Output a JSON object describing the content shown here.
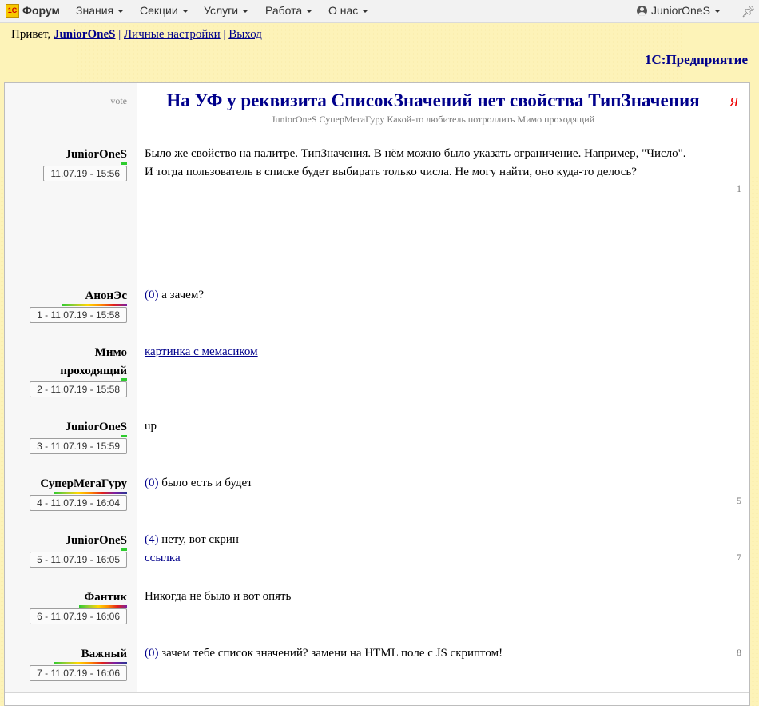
{
  "topnav": {
    "logo_text": "1C",
    "brand": "Форум",
    "menus": [
      "Знания",
      "Секции",
      "Услуги",
      "Работа",
      "О нас"
    ],
    "user": "JuniorOneS"
  },
  "greeting": {
    "prefix": "Привет,",
    "username": "JuniorOneS",
    "sep1": "|",
    "settings": "Личные настройки",
    "sep2": "|",
    "logout": "Выход"
  },
  "section_title": "1С:Предприятие",
  "topic": {
    "vote_label": "vote",
    "title": "На УФ у реквизита СписокЗначений нет свойства ТипЗначения",
    "participants": "JuniorOneS СуперМегаГуру Какой-то любитель потроллить Мимо проходящий",
    "ya_icon": "Я"
  },
  "posts": [
    {
      "author": "JuniorOneS",
      "timestamp": "11.07.19 - 15:56",
      "text": "Было же свойство на палитре. ТипЗначения. В нём можно было указать ограничение. Например, \"Число\". И тогда пользователь в списке будет выбирать только числа. Не могу найти, оно куда-то делось?",
      "num": "1"
    },
    {
      "author": "АнонЭс",
      "timestamp": "1 - 11.07.19 - 15:58",
      "ref": "(0)",
      "text": "а зачем?"
    },
    {
      "author_line1": "Мимо",
      "author_line2": "проходящий",
      "timestamp": "2 - 11.07.19 - 15:58",
      "link": "картинка с мемасиком"
    },
    {
      "author": "JuniorOneS",
      "timestamp": "3 - 11.07.19 - 15:59",
      "text": "up"
    },
    {
      "author": "СуперМегаГуру",
      "timestamp": "4 - 11.07.19 - 16:04",
      "ref": "(0)",
      "text": "было есть и будет",
      "num": "5"
    },
    {
      "author": "JuniorOneS",
      "timestamp": "5 - 11.07.19 - 16:05",
      "ref": "(4)",
      "text": "нету, вот скрин",
      "link": "ссылка",
      "num": "7"
    },
    {
      "author": "Фантик",
      "timestamp": "6 - 11.07.19 - 16:06",
      "text": "Никогда не было и вот опять"
    },
    {
      "author": "Важный",
      "timestamp": "7 - 11.07.19 - 16:06",
      "ref": "(0)",
      "text": "зачем тебе список значений? замени на HTML поле с JS скриптом!",
      "num": "8"
    }
  ]
}
